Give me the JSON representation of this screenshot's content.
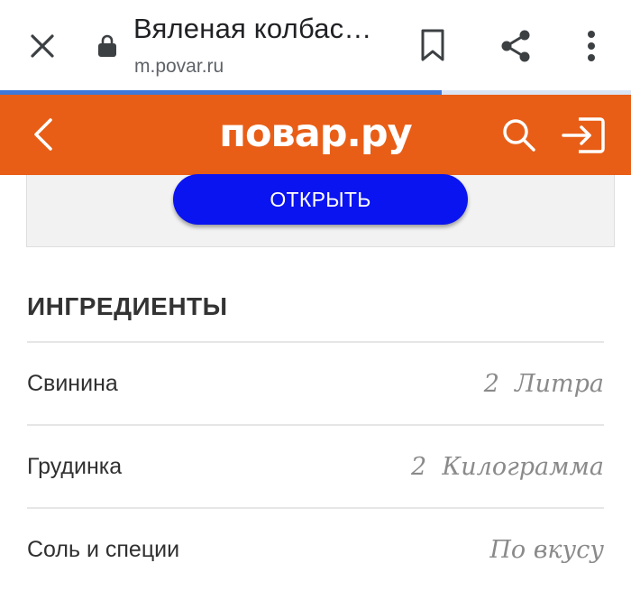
{
  "browser": {
    "title": "Вяленая колбас…",
    "url": "m.povar.ru",
    "load_progress": 0.7
  },
  "header": {
    "logo": "повар.ру"
  },
  "ad": {
    "button_label": "ОТКРЫТЬ"
  },
  "ingredients": {
    "title": "ИНГРЕДИЕНТЫ",
    "items": [
      {
        "name": "Свинина",
        "amount": "2  Литра"
      },
      {
        "name": "Грудинка",
        "amount": "2  Килограмма"
      },
      {
        "name": "Соль и специи",
        "amount": "По вкусу"
      }
    ]
  },
  "colors": {
    "header_bg": "#e85e17",
    "button_bg": "#0a14f0",
    "progress": "#3f78d8"
  },
  "icons": [
    "close-icon",
    "lock-icon",
    "bookmark-icon",
    "share-icon",
    "more-vert-icon",
    "chevron-left-icon",
    "search-icon",
    "login-icon"
  ]
}
